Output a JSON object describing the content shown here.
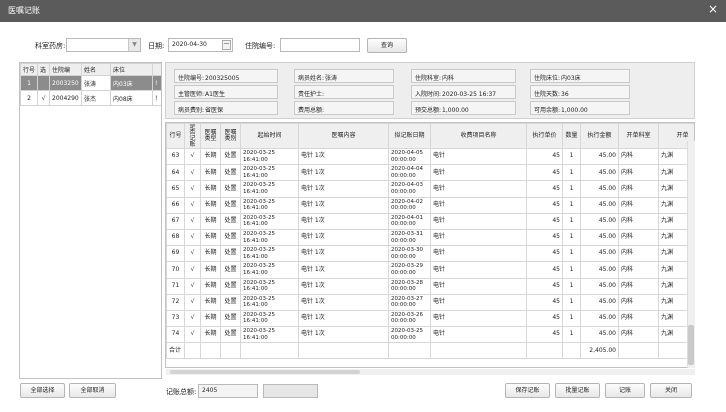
{
  "window": {
    "title": "医嘱记账",
    "close_glyph": "×"
  },
  "filters": {
    "dept_label": "科室药房:",
    "dept_value": "",
    "date_label": "日期:",
    "date_value": "2020-04-30",
    "admission_label": "住院编号:",
    "admission_value": "",
    "query_label": "查询"
  },
  "left_grid": {
    "headers": [
      "行号",
      "选",
      "住院编",
      "姓名",
      "床位"
    ],
    "rows": [
      {
        "no": "1",
        "sel": "",
        "id": "2003250",
        "name": "张涛",
        "bed": "内03床"
      },
      {
        "no": "2",
        "sel": "√",
        "id": "2004290",
        "name": "张杰",
        "bed": "内08床"
      }
    ],
    "marker": "!"
  },
  "patient_info": {
    "admission_no_label": "住院编号:",
    "admission_no": "200325005",
    "patient_name_label": "病员姓名:",
    "patient_name": "张涛",
    "dept_label": "住院科室:",
    "dept": "内科",
    "bed_label": "住院床位:",
    "bed": "内03床",
    "doctor_label": "主管医师:",
    "doctor": "A1医生",
    "nurse_label": "责任护士:",
    "nurse": "",
    "admit_time_label": "入院时间:",
    "admit_time": "2020-03-25 16:37",
    "days_label": "住院天数:",
    "days": "36",
    "category_label": "病员费别:",
    "category": "省医保",
    "total_fee_label": "费用总额:",
    "total_fee": "",
    "prepaid_label": "预交总额:",
    "prepaid": "1,000.00",
    "balance_label": "可用余额:",
    "balance": "1,000.00"
  },
  "order_grid": {
    "headers": [
      "行号",
      "是否记账",
      "医嘱类型",
      "医嘱类别",
      "起始时间",
      "医嘱内容",
      "拟记账日期",
      "收费项目名称",
      "执行单价",
      "数量",
      "执行金额",
      "开单科室",
      "开单"
    ],
    "rows": [
      {
        "no": "63",
        "chk": "√",
        "type": "长期",
        "cat": "处置",
        "start": "2020-03-25 16:41:00",
        "content": "电针 1次",
        "date": "2020-04-05 00:00:00",
        "item": "电针",
        "price": "45",
        "qty": "1",
        "amount": "45.00",
        "dept": "内科",
        "doc": "九渊"
      },
      {
        "no": "64",
        "chk": "√",
        "type": "长期",
        "cat": "处置",
        "start": "2020-03-25 16:41:00",
        "content": "电针 1次",
        "date": "2020-04-04 00:00:00",
        "item": "电针",
        "price": "45",
        "qty": "1",
        "amount": "45.00",
        "dept": "内科",
        "doc": "九渊"
      },
      {
        "no": "65",
        "chk": "√",
        "type": "长期",
        "cat": "处置",
        "start": "2020-03-25 16:41:00",
        "content": "电针 1次",
        "date": "2020-04-03 00:00:00",
        "item": "电针",
        "price": "45",
        "qty": "1",
        "amount": "45.00",
        "dept": "内科",
        "doc": "九渊"
      },
      {
        "no": "66",
        "chk": "√",
        "type": "长期",
        "cat": "处置",
        "start": "2020-03-25 16:41:00",
        "content": "电针 1次",
        "date": "2020-04-02 00:00:00",
        "item": "电针",
        "price": "45",
        "qty": "1",
        "amount": "45.00",
        "dept": "内科",
        "doc": "九渊"
      },
      {
        "no": "67",
        "chk": "√",
        "type": "长期",
        "cat": "处置",
        "start": "2020-03-25 16:41:00",
        "content": "电针 1次",
        "date": "2020-04-01 00:00:00",
        "item": "电针",
        "price": "45",
        "qty": "1",
        "amount": "45.00",
        "dept": "内科",
        "doc": "九渊"
      },
      {
        "no": "68",
        "chk": "√",
        "type": "长期",
        "cat": "处置",
        "start": "2020-03-25 16:41:00",
        "content": "电针 1次",
        "date": "2020-03-31 00:00:00",
        "item": "电针",
        "price": "45",
        "qty": "1",
        "amount": "45.00",
        "dept": "内科",
        "doc": "九渊"
      },
      {
        "no": "69",
        "chk": "√",
        "type": "长期",
        "cat": "处置",
        "start": "2020-03-25 16:41:00",
        "content": "电针 1次",
        "date": "2020-03-30 00:00:00",
        "item": "电针",
        "price": "45",
        "qty": "1",
        "amount": "45.00",
        "dept": "内科",
        "doc": "九渊"
      },
      {
        "no": "70",
        "chk": "√",
        "type": "长期",
        "cat": "处置",
        "start": "2020-03-25 16:41:00",
        "content": "电针 1次",
        "date": "2020-03-29 00:00:00",
        "item": "电针",
        "price": "45",
        "qty": "1",
        "amount": "45.00",
        "dept": "内科",
        "doc": "九渊"
      },
      {
        "no": "71",
        "chk": "√",
        "type": "长期",
        "cat": "处置",
        "start": "2020-03-25 16:41:00",
        "content": "电针 1次",
        "date": "2020-03-28 00:00:00",
        "item": "电针",
        "price": "45",
        "qty": "1",
        "amount": "45.00",
        "dept": "内科",
        "doc": "九渊"
      },
      {
        "no": "72",
        "chk": "√",
        "type": "长期",
        "cat": "处置",
        "start": "2020-03-25 16:41:00",
        "content": "电针 1次",
        "date": "2020-03-27 00:00:00",
        "item": "电针",
        "price": "45",
        "qty": "1",
        "amount": "45.00",
        "dept": "内科",
        "doc": "九渊"
      },
      {
        "no": "73",
        "chk": "√",
        "type": "长期",
        "cat": "处置",
        "start": "2020-03-25 16:41:00",
        "content": "电针 1次",
        "date": "2020-03-26 00:00:00",
        "item": "电针",
        "price": "45",
        "qty": "1",
        "amount": "45.00",
        "dept": "内科",
        "doc": "九渊"
      },
      {
        "no": "74",
        "chk": "√",
        "type": "长期",
        "cat": "处置",
        "start": "2020-03-25 16:41:00",
        "content": "电针 1次",
        "date": "2020-03-25 00:00:00",
        "item": "电针",
        "price": "45",
        "qty": "1",
        "amount": "45.00",
        "dept": "内科",
        "doc": "九渊"
      }
    ],
    "total_label": "合计",
    "total_amount": "2,405.00"
  },
  "footer": {
    "select_all": "全部选择",
    "cancel_all": "全部取消",
    "record_total_label": "记账总额:",
    "record_total": "2405",
    "save_record": "保存记账",
    "batch_record": "批量记账",
    "record": "记账",
    "close": "关闭"
  }
}
